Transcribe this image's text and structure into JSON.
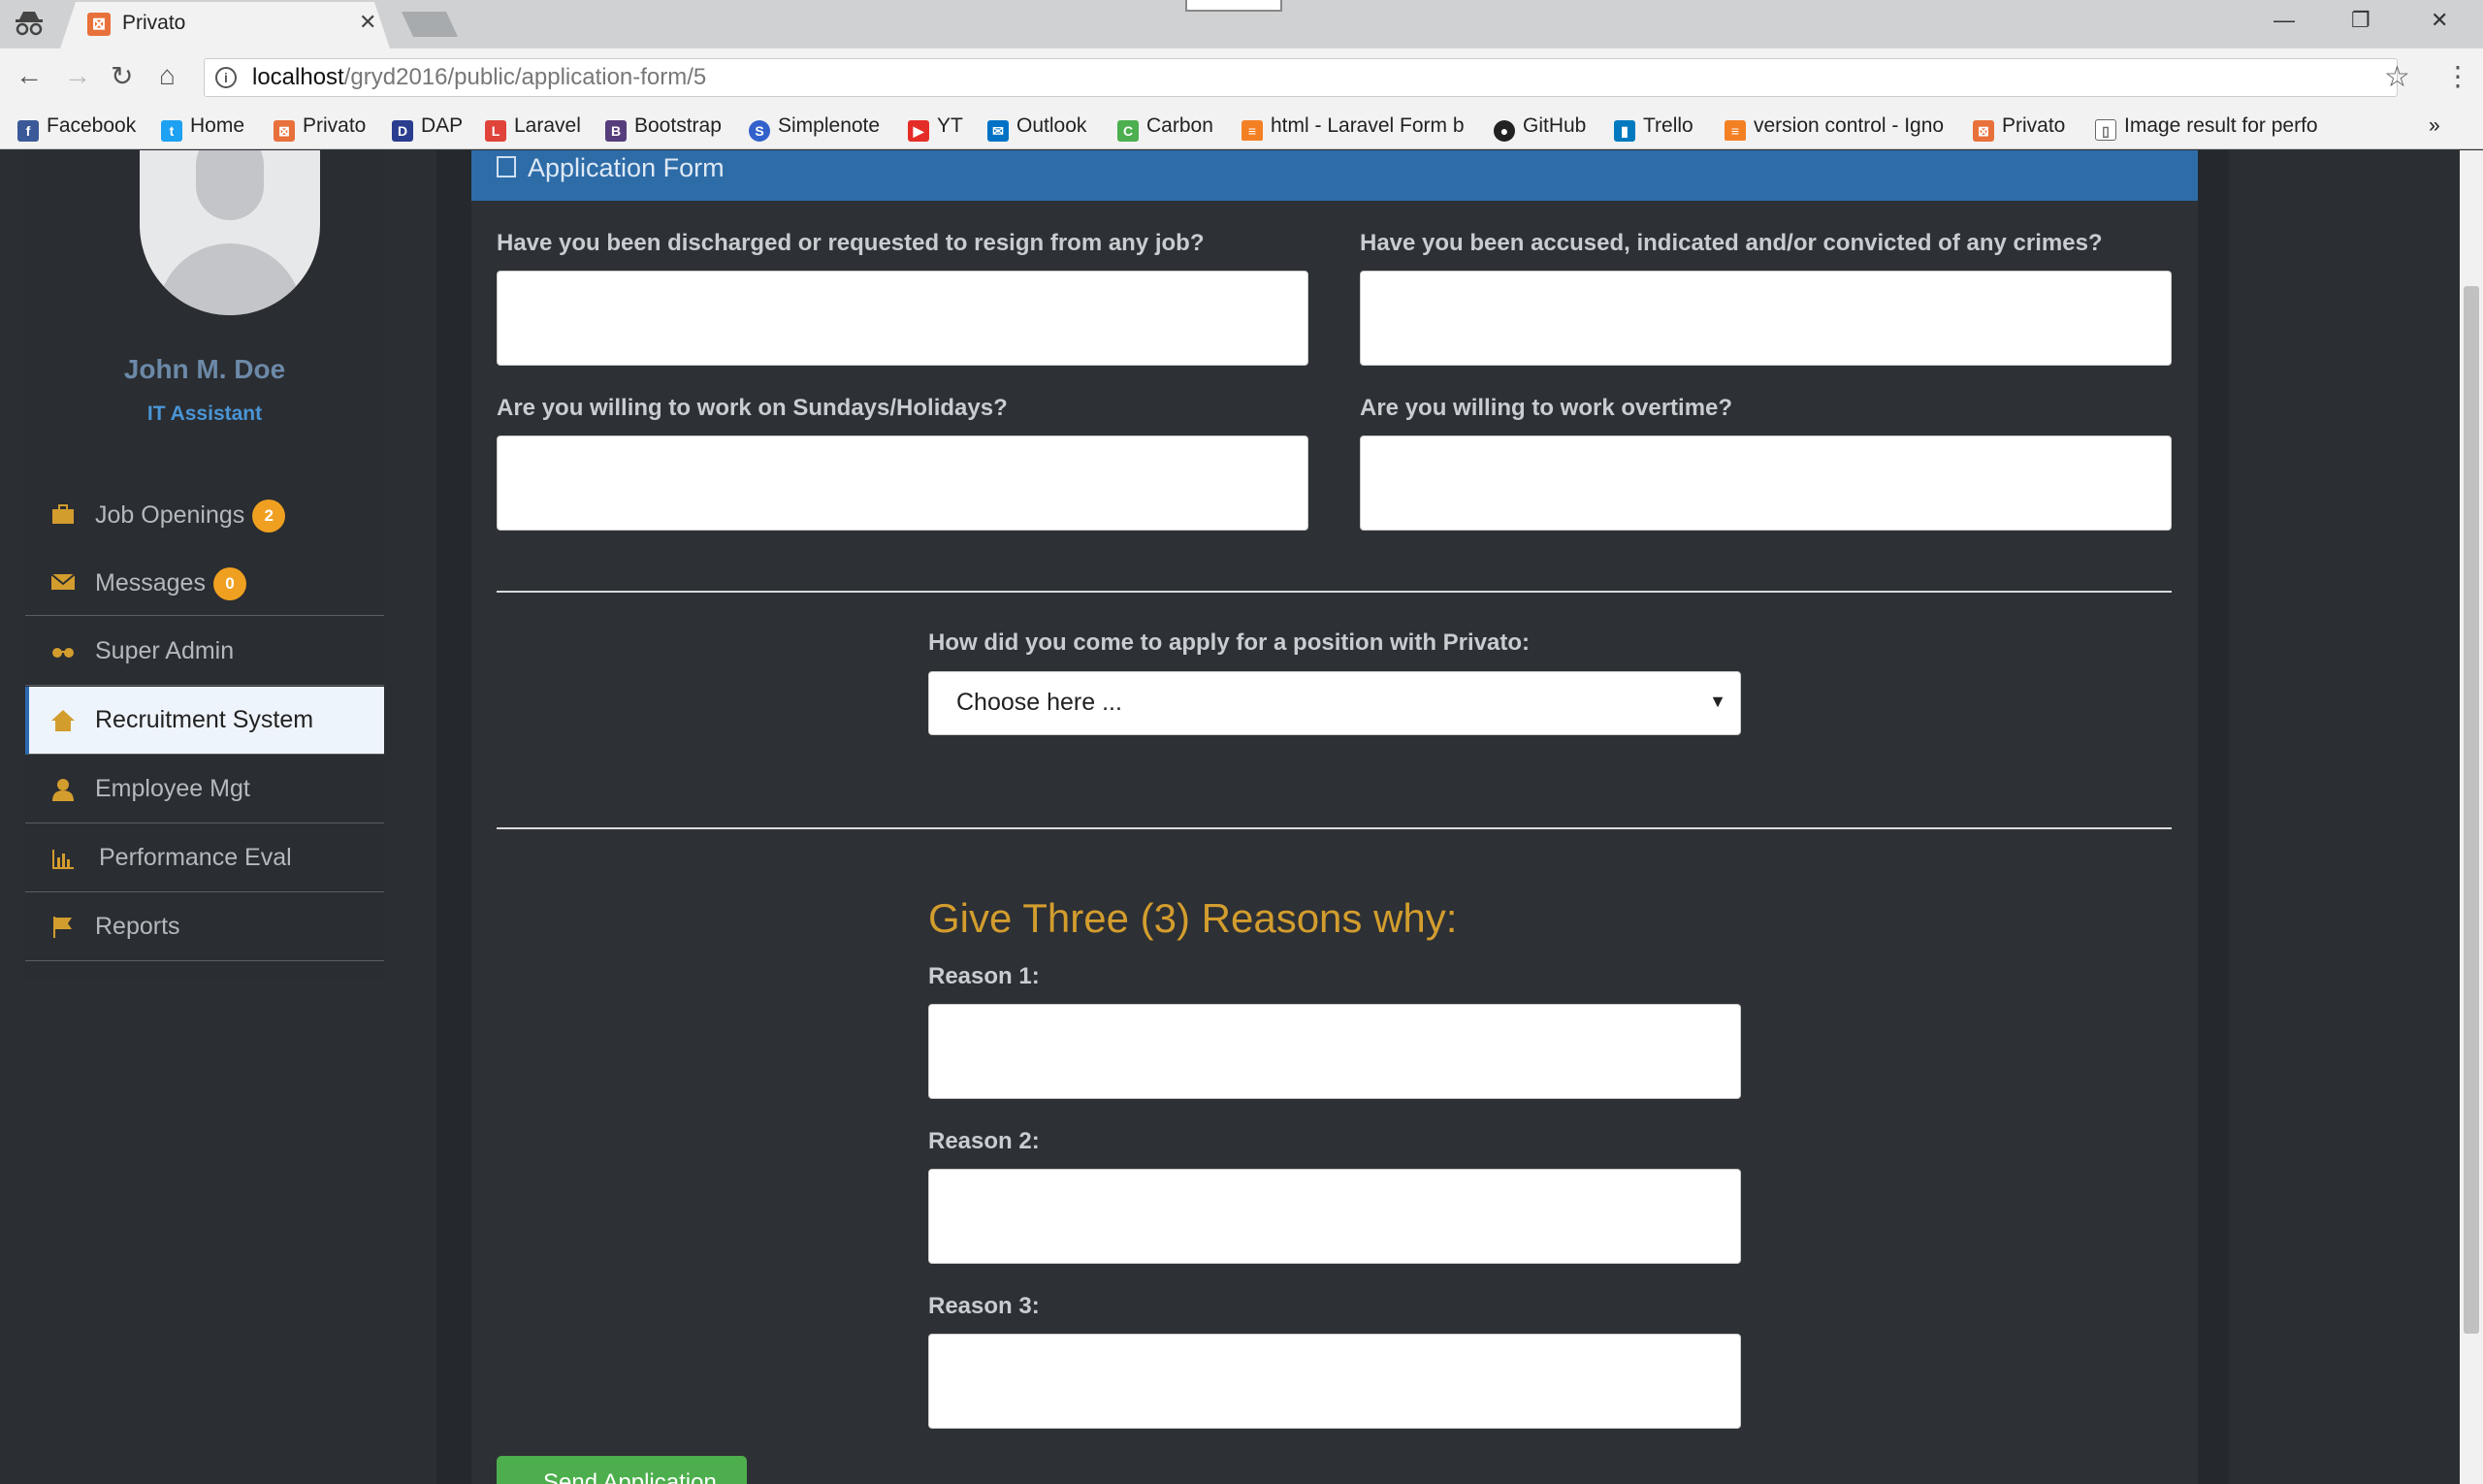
{
  "browser": {
    "tab_title": "Privato",
    "url_host": "localhost",
    "url_path": "/gryd2016/public/application-form/5",
    "bookmarks": [
      "Facebook",
      "Home",
      "Privato",
      "DAP",
      "Laravel",
      "Bootstrap",
      "Simplenote",
      "YT",
      "Outlook",
      "Carbon",
      "html - Laravel Form b",
      "GitHub",
      "Trello",
      "version control - Igno",
      "Privato",
      "Image result for perfo"
    ],
    "overflow": "»"
  },
  "user": {
    "name": "John M. Doe",
    "role": "IT Assistant"
  },
  "sidebar": {
    "items": [
      {
        "label": "Job Openings",
        "badge": "2"
      },
      {
        "label": "Messages",
        "badge": "0"
      },
      {
        "label": "Super Admin"
      },
      {
        "label": "Recruitment System"
      },
      {
        "label": "Employee Mgt"
      },
      {
        "label": "Performance Eval"
      },
      {
        "label": "Reports"
      }
    ]
  },
  "form": {
    "title": "Application Form",
    "q_discharged": "Have you been discharged or requested to resign from any job?",
    "q_crimes": "Have you been accused, indicated and/or convicted of any crimes?",
    "q_sundays": "Are you willing to work on Sundays/Holidays?",
    "q_overtime": "Are you willing to work overtime?",
    "q_how_apply": "How did you come to apply for a position with Privato:",
    "how_apply_value": "Choose here ...",
    "reasons_title": "Give Three (3) Reasons why:",
    "reason1": "Reason 1:",
    "reason2": "Reason 2:",
    "reason3": "Reason 3:",
    "send_label": "Send Application"
  },
  "colors": {
    "accent": "#2e6ca8",
    "reasons_title": "#d39d2e",
    "badge": "#f0a020",
    "send": "#4cae4c"
  }
}
